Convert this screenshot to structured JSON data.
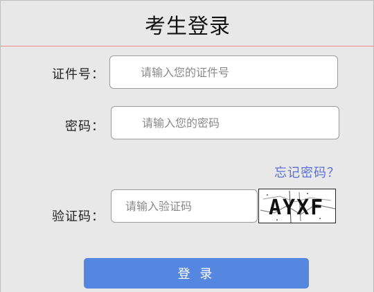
{
  "title": "考生登录",
  "fields": {
    "id_number": {
      "label": "证件号：",
      "placeholder": "请输入您的证件号",
      "value": ""
    },
    "password": {
      "label": "密码：",
      "placeholder": "请输入您的密码",
      "value": ""
    },
    "captcha": {
      "label": "验证码：",
      "placeholder": "请输入验证码",
      "value": "",
      "image_text": "AYXF"
    }
  },
  "links": {
    "forgot_password": "忘记密码？"
  },
  "buttons": {
    "login": "登 录"
  },
  "colors": {
    "background": "#e8e8e8",
    "divider": "#f08a8a",
    "link": "#5a6fd8",
    "primary_button": "#5587e0"
  }
}
